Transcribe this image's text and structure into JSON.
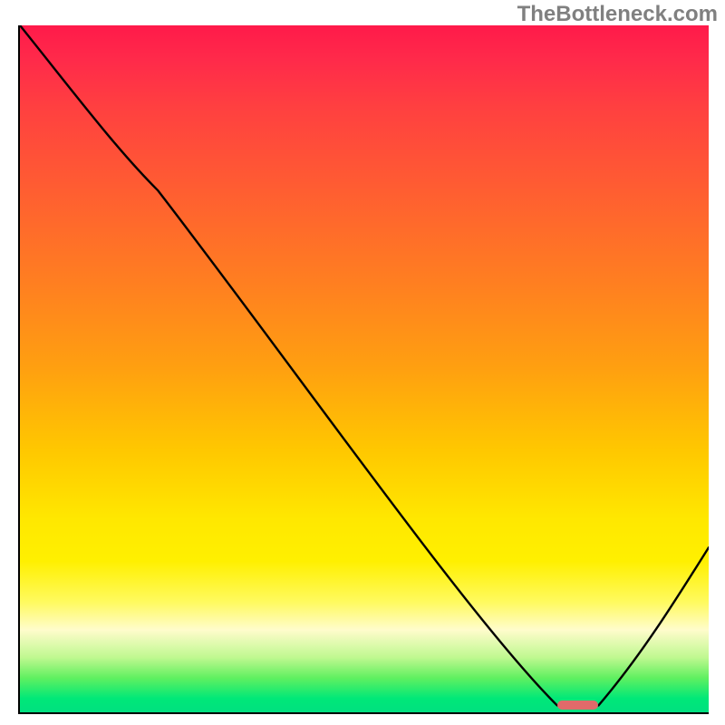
{
  "watermark": "TheBottleneck.com",
  "chart_data": {
    "type": "line",
    "title": "",
    "xlabel": "",
    "ylabel": "",
    "xlim": [
      0,
      100
    ],
    "ylim": [
      0,
      100
    ],
    "x": [
      0,
      20,
      78,
      84,
      100
    ],
    "values": [
      100,
      76,
      1,
      1,
      24
    ],
    "marker": {
      "x_start": 78,
      "x_end": 84,
      "y": 1,
      "color": "#e16a6a"
    },
    "background_gradient": {
      "stops": [
        {
          "pos": 0,
          "color": "#ff1a4a"
        },
        {
          "pos": 25,
          "color": "#ff6030"
        },
        {
          "pos": 50,
          "color": "#ffa010"
        },
        {
          "pos": 72,
          "color": "#ffe800"
        },
        {
          "pos": 88,
          "color": "#fffccc"
        },
        {
          "pos": 100,
          "color": "#00e080"
        }
      ]
    }
  }
}
